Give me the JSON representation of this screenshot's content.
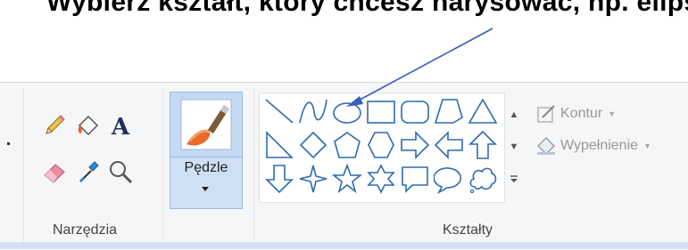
{
  "heading": {
    "text": "Wybierz kształt, który chcesz narysować, np. elipsę"
  },
  "ribbon": {
    "tools_group": {
      "label": "Narzędzia",
      "tools": [
        "pencil-icon",
        "fill-bucket-icon",
        "text-icon",
        "eraser-icon",
        "color-picker-icon",
        "magnifier-icon"
      ]
    },
    "brushes": {
      "label": "Pędzle"
    },
    "shapes_group": {
      "label": "Kształty",
      "shapes": [
        "line-shape",
        "curve-shape",
        "oval-shape",
        "rectangle-shape",
        "rounded-rectangle-shape",
        "polygon-shape",
        "triangle-shape",
        "right-triangle-shape",
        "diamond-shape",
        "pentagon-shape",
        "hexagon-shape",
        "right-arrow-shape",
        "left-arrow-shape",
        "up-arrow-shape",
        "down-arrow-shape",
        "four-point-star-shape",
        "five-point-star-shape",
        "six-point-star-shape",
        "rect-callout-shape",
        "oval-callout-shape",
        "cloud-callout-shape"
      ],
      "selected": "oval-shape"
    },
    "outline": {
      "label": "Kontur"
    },
    "fill": {
      "label": "Wypełnienie"
    }
  },
  "colors": {
    "shape_stroke": "#2b6cb0",
    "arrow": "#3a5bc4",
    "ribbon_bg": "#f5f6f7",
    "brush_bg": "#c4daf4"
  }
}
